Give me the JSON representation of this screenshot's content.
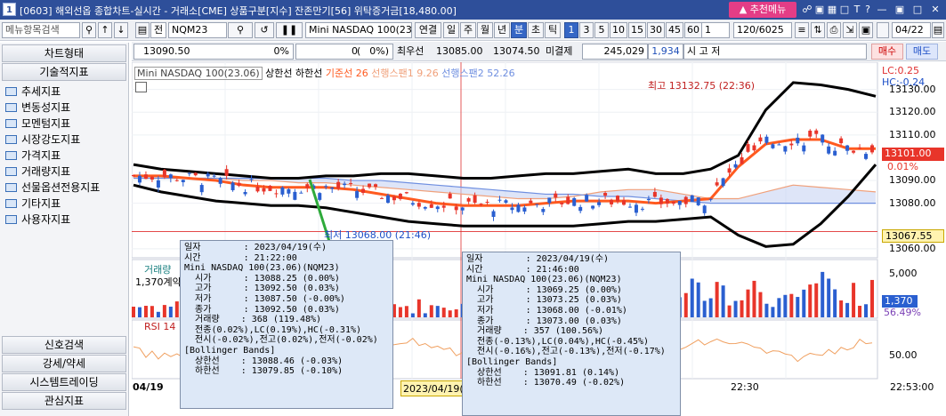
{
  "window": {
    "title": "[0603] 해외선옵 종합차트-실시간 - 거래소[CME] 상품구분[지수] 잔존만기[56] 위탁증거금[18,480.00]",
    "badge": "1",
    "recommend_label": "추천메뉴"
  },
  "toolbar": {
    "menu_search_placeholder": "메뉴항목검색",
    "type_label": "전",
    "symbol": "NQM23",
    "product_name": "Mini NASDAQ 100(23.0",
    "btn_continuous": "연결",
    "period_buttons": [
      "일",
      "주",
      "월",
      "년",
      "분",
      "초",
      "틱"
    ],
    "active_period": "분",
    "interval_buttons": [
      "1",
      "3",
      "5",
      "10",
      "15",
      "30",
      "45",
      "60"
    ],
    "active_interval": "1",
    "interval_value": "1",
    "count_value": "120/6025",
    "date_value": "04/22"
  },
  "quote": {
    "price": "13090.50",
    "change_pct": "0%",
    "zero_field": "0",
    "open_paren": "(",
    "pct_paren": "0%)",
    "best_bid_label": "최우선",
    "best_bid": "13085.00",
    "best_ask": "13074.50",
    "open_interest_label": "미결제",
    "open_interest": "245,029",
    "oi_change": "1,934",
    "market_status": "시   고   저",
    "buy_label": "매수",
    "sell_label": "매도"
  },
  "sidebar": {
    "chart_type_label": "차트형태",
    "tech_label": "기술적지표",
    "items": [
      "추세지표",
      "변동성지표",
      "모멘텀지표",
      "시장강도지표",
      "가격지표",
      "거래량지표",
      "선물옵션전용지표",
      "기타지표",
      "사용자지표"
    ],
    "bottom": [
      "신호검색",
      "강세/약세",
      "시스템트레이딩",
      "관심지표"
    ]
  },
  "chart": {
    "legend_name": "Mini NASDAQ 100(23.06)",
    "legend_upper": "상한선",
    "legend_lower": "하한선",
    "legend_base": "기준선 26",
    "legend_span1": "선행스팬1 9.26",
    "legend_span2": "선행스팬2 52.26",
    "lc": "LC:0.25",
    "hc": "HC:-0.24",
    "high_marker": "최고 13132.75 (22:36)",
    "low_marker": "최저 13068.00 (21:46)",
    "price_ticks": [
      "13130.00",
      "13120.00",
      "13110.00",
      "13090.00",
      "13080.00",
      "13060.00"
    ],
    "current_price": "13101.00",
    "current_pct": "0.01%",
    "crosshair_price": "13067.55",
    "volume_label": "거래량",
    "volume_value": "1,370계약",
    "volume_ticks": [
      "5,000"
    ],
    "volume_current": "1,370",
    "volume_pct": "56.49%",
    "rsi_label": "RSI 14",
    "rsi_tick": "50.00",
    "time_first": "04/19",
    "time_cross": "2023/04/19(수)",
    "time_mid": "22:30",
    "time_right": "22:53:00",
    "colors": {
      "up": "#e8352a",
      "down": "#2a5fd0",
      "base": "#ff5a1f",
      "span1": "#f0a07a",
      "span2": "#6f8fe0",
      "bollinger": "#000000",
      "crosshair": "#e03030"
    }
  },
  "tooltip1": {
    "lines": [
      "일자        : 2023/04/19(수)",
      "시간        : 21:22:00",
      "Mini NASDAQ 100(23.06)(NQM23)",
      "  시가      : 13088.25 (0.00%)",
      "  고가      : 13092.50 (0.03%)",
      "  저가      : 13087.50 (-0.00%)",
      "  종가      : 13092.50 (0.03%)",
      "  거래량    : 368 (119.48%)",
      "  전종(0.02%),LC(0.19%),HC(-0.31%)",
      "  전시(-0.02%),전고(0.02%),전저(-0.02%)",
      "[Bollinger Bands]",
      "  상한선    : 13088.46 (-0.03%)",
      "  하한선    : 13079.85 (-0.10%)"
    ]
  },
  "tooltip2": {
    "lines": [
      "일자        : 2023/04/19(수)",
      "시간        : 21:46:00",
      "Mini NASDAQ 100(23.06)(NQM23)",
      "  시가      : 13069.25 (0.00%)",
      "  고가      : 13073.25 (0.03%)",
      "  저가      : 13068.00 (-0.01%)",
      "  종가      : 13073.00 (0.03%)",
      "  거래량    : 357 (100.56%)",
      "  전종(-0.13%),LC(0.04%),HC(-0.45%)",
      "  전시(-0.16%),전고(-0.13%),전저(-0.17%)",
      "[Bollinger Bands]",
      "  상한선    : 13091.81 (0.14%)",
      "  하한선    : 13070.49 (-0.02%)"
    ]
  },
  "chart_data": {
    "type": "candlestick",
    "title": "Mini NASDAQ 100(23.06)",
    "ylim": [
      13058,
      13140
    ],
    "series": [
      {
        "name": "상한선",
        "values": [
          13097,
          13095,
          13094,
          13093,
          13092,
          13091,
          13091,
          13092,
          13092,
          13093,
          13093,
          13092,
          13091,
          13091,
          13092,
          13093,
          13093,
          13094,
          13095,
          13093,
          13093,
          13095,
          13101,
          13121,
          13133,
          13132,
          13130,
          13127
        ]
      },
      {
        "name": "하한선",
        "values": [
          13088,
          13085,
          13083,
          13081,
          13080,
          13079,
          13079,
          13078,
          13076,
          13074,
          13072,
          13071,
          13070,
          13070,
          13070,
          13070,
          13070,
          13071,
          13072,
          13072,
          13073,
          13074,
          13066,
          13061,
          13062,
          13071,
          13083,
          13097
        ]
      },
      {
        "name": "기준선 26",
        "values": [
          13092,
          13092,
          13091,
          13090,
          13088,
          13087,
          13087,
          13087,
          13086,
          13084,
          13082,
          13080,
          13079,
          13079,
          13079,
          13080,
          13081,
          13081,
          13081,
          13080,
          13081,
          13082,
          13096,
          13106,
          13108,
          13108,
          13104,
          13104
        ]
      },
      {
        "name": "선행스팬1 9.26",
        "values": [
          13091,
          13091,
          13091,
          13091,
          13090,
          13090,
          13089,
          13089,
          13088,
          13087,
          13086,
          13085,
          13084,
          13083,
          13082,
          13082,
          13083,
          13085,
          13086,
          13086,
          13084,
          13082,
          13082,
          13085,
          13088,
          13087,
          13086,
          13085
        ]
      },
      {
        "name": "선행스팬2 52.26",
        "values": [
          13091,
          13091,
          13091,
          13091,
          13091,
          13091,
          13091,
          13091,
          13090,
          13090,
          13089,
          13088,
          13087,
          13086,
          13085,
          13084,
          13084,
          13083,
          13083,
          13082,
          13081,
          13080,
          13080,
          13080,
          13080,
          13080,
          13080,
          13080
        ]
      }
    ],
    "high": {
      "value": 13132.75,
      "time": "22:36"
    },
    "low": {
      "value": 13068.0,
      "time": "21:46"
    },
    "current": 13101.0
  }
}
